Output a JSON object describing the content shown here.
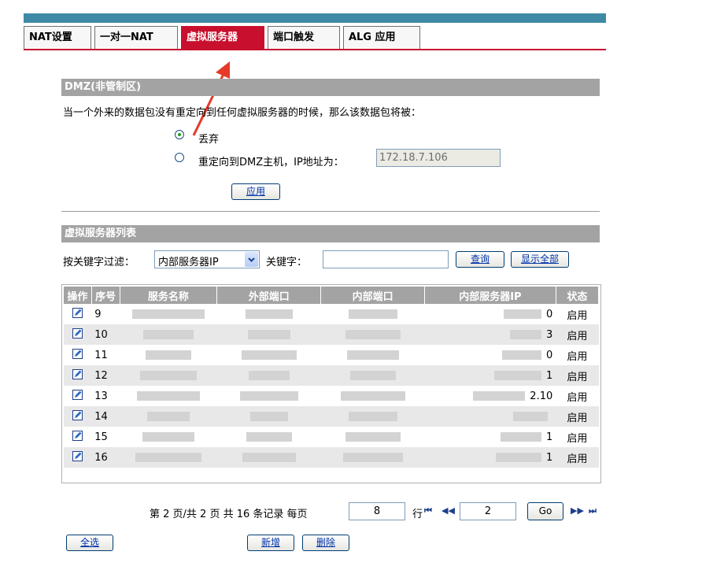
{
  "tabs": [
    {
      "label": "NAT设置",
      "active": false
    },
    {
      "label": "一对一NAT",
      "active": false
    },
    {
      "label": "虚拟服务器",
      "active": true
    },
    {
      "label": "端口触发",
      "active": false
    },
    {
      "label": "ALG 应用",
      "active": false
    }
  ],
  "dmz": {
    "title": "DMZ(非管制区)",
    "description": "当一个外来的数据包没有重定向到任何虚拟服务器的时候，那么该数据包将被：",
    "option_drop": "丢弃",
    "option_redirect": "重定向到DMZ主机，IP地址为：",
    "selected": "drop",
    "dmz_ip": "172.18.7.106",
    "apply_label": "应用"
  },
  "server_list": {
    "title": "虚拟服务器列表",
    "filter_label": "按关键字过滤：",
    "filter_select": "内部服务器IP",
    "keyword_label": "关键字：",
    "keyword_value": "",
    "query_label": "查询",
    "show_all_label": "显示全部"
  },
  "table": {
    "headers": [
      "操作",
      "序号",
      "服务名称",
      "外部端口",
      "内部端口",
      "内部服务器IP",
      "状态"
    ],
    "rows": [
      {
        "index": "9",
        "ip_tail": "0",
        "status": "启用"
      },
      {
        "index": "10",
        "ip_tail": "3",
        "status": "启用"
      },
      {
        "index": "11",
        "ip_tail": "0",
        "status": "启用"
      },
      {
        "index": "12",
        "ip_tail": "1",
        "status": "启用"
      },
      {
        "index": "13",
        "ip_tail": "2.10",
        "status": "启用"
      },
      {
        "index": "14",
        "ip_tail": "",
        "status": "启用"
      },
      {
        "index": "15",
        "ip_tail": "1",
        "status": "启用"
      },
      {
        "index": "16",
        "ip_tail": "1",
        "status": "启用"
      }
    ]
  },
  "pagination": {
    "summary": "第 2 页/共 2 页 共 16 条记录 每页",
    "per_page": "8",
    "row_label": "行",
    "page_input": "2",
    "go_label": "Go"
  },
  "footer": {
    "select_all_label": "全选",
    "add_label": "新增",
    "delete_label": "删除"
  },
  "colors": {
    "active_tab": "#c8102e",
    "top_bar": "#3e8aa6",
    "section_bar": "#a3a3a3",
    "annotation_arrow": "#e53a28"
  }
}
